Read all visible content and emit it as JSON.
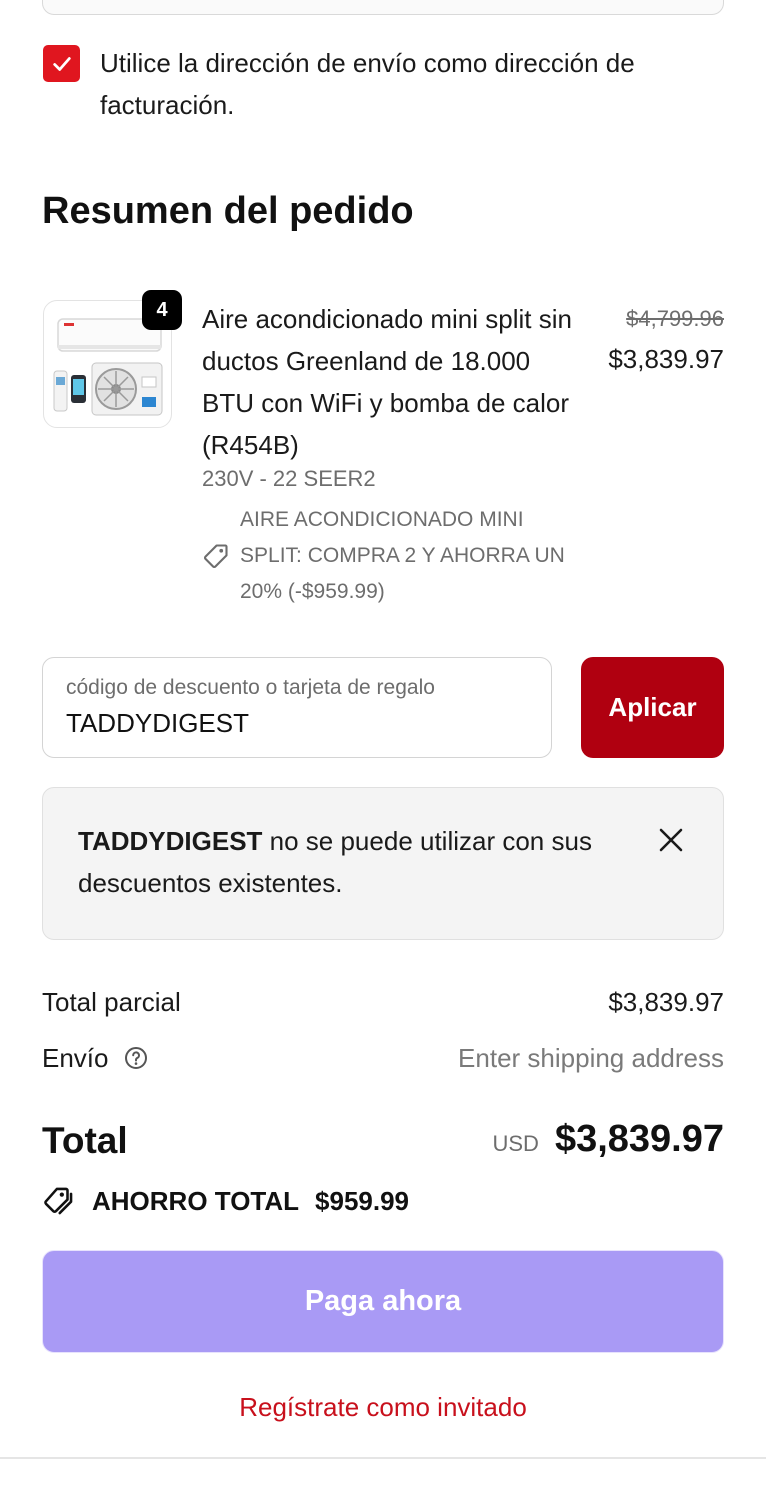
{
  "billing": {
    "checked": true,
    "label": "Utilice la dirección de envío como dirección de facturación."
  },
  "summary": {
    "title": "Resumen del pedido"
  },
  "product": {
    "quantity": "4",
    "name": "Aire acondicionado mini split sin ductos Greenland de 18.000 BTU con WiFi y bomba de calor (R454B)",
    "variant": "230V - 22 SEER2",
    "discount": "AIRE ACONDICIONADO MINI SPLIT: COMPRA 2 Y AHORRA UN 20% (-$959.99)",
    "price_original": "$4,799.96",
    "price_current": "$3,839.97",
    "image_icon": "mini-split-air-conditioner"
  },
  "discount_code": {
    "placeholder": "código de descuento o tarjeta de regalo",
    "value": "TADDYDIGEST",
    "apply_label": "Aplicar"
  },
  "alert": {
    "code": "TADDYDIGEST",
    "message": " no se puede utilizar con sus descuentos existentes."
  },
  "totals": {
    "subtotal_label": "Total parcial",
    "subtotal_value": "$3,839.97",
    "shipping_label": "Envío",
    "shipping_value": "Enter shipping address",
    "total_label": "Total",
    "currency": "USD",
    "total_value": "$3,839.97",
    "savings_label": "AHORRO TOTAL",
    "savings_value": "$959.99"
  },
  "actions": {
    "pay_label": "Paga ahora",
    "guest_label": "Regístrate como invitado"
  },
  "colors": {
    "checkbox": "#e0161f",
    "apply_button": "#b00010",
    "pay_button": "#a99af5",
    "guest_link": "#c8101c"
  }
}
